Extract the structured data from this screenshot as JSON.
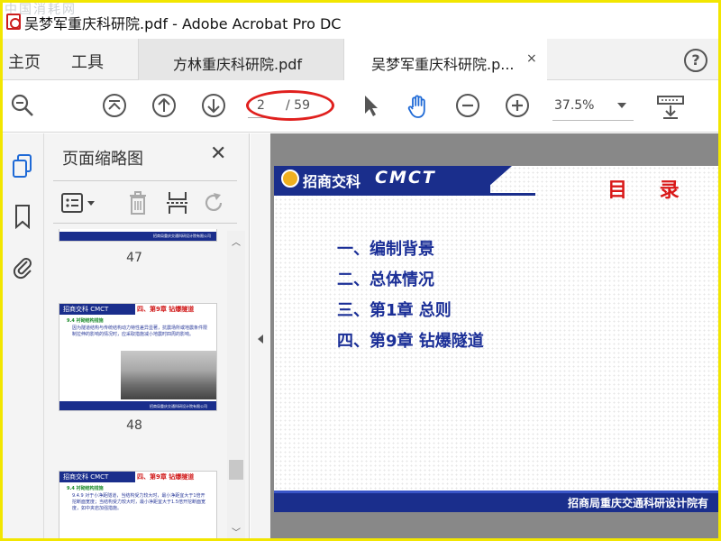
{
  "window": {
    "title": "吴梦军重庆科研院.pdf - Adobe Acrobat Pro DC",
    "watermark": "中国消耗网"
  },
  "tabbar": {
    "home": "主页",
    "tools": "工具",
    "doc_tabs": [
      {
        "label": "方林重庆科研院.pdf",
        "active": false
      },
      {
        "label": "吴梦军重庆科研院.p...",
        "active": true
      }
    ],
    "close_glyph": "×",
    "help_glyph": "?"
  },
  "toolbar": {
    "current_page": "2",
    "total_pages": "/ 59",
    "zoom": "37.5%",
    "highlight_color": "#e0201e"
  },
  "panel": {
    "title": "页面缩略图",
    "close_glyph": "✕",
    "thumbnails": [
      {
        "label": "47",
        "footer": "招商局重庆交通科研设计院有限公司"
      },
      {
        "label": "48",
        "header": "招商交科 CMCT",
        "title": "四、第9章 钻爆隧道",
        "section": "9.4  衬砌结构措施",
        "body": "因为隧道结构与传统结构动力特性差异显著，抗震场所或地震条件限制拉伸的影响的情况时，应采取措施减小地震时四周的影响。",
        "footer": "招商局重庆交通科研设计院有限公司"
      },
      {
        "label": "49",
        "header": "招商交科 CMCT",
        "title": "四、第9章 钻爆隧道",
        "section": "9.4  衬砌结构措施",
        "body": "9.4.9 对于小净距隧道，当结构受力较大时，最小净距宜大于1倍开挖断面宽度；当结构受力较大时，最小净距宜大于1.5倍开挖断面宽度，如中夹岩加强措施。"
      }
    ]
  },
  "document": {
    "brand_cn": "招商交科",
    "brand_en": "CMCT",
    "heading": "目  录",
    "toc": [
      "一、编制背景",
      "二、总体情况",
      "三、第1章 总则",
      "四、第9章 钻爆隧道"
    ],
    "footer": "招商局重庆交通科研设计院有",
    "brand_color": "#1a2e8c",
    "heading_color": "#d91818"
  }
}
